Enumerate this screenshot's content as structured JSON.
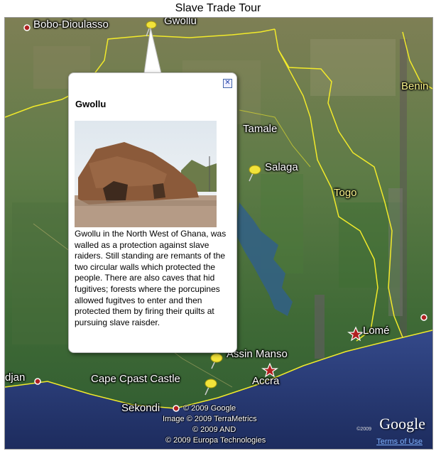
{
  "page_title": "Slave Trade Tour",
  "map": {
    "labels": {
      "bobo": "Bobo-Dioulasso",
      "gwollu_map": "Gwollu",
      "tamale": "Tamale",
      "salaga": "Salaga",
      "benin": "Benin",
      "togo": "Togo",
      "lome": "Lomé",
      "assin_manso": "Assin Manso",
      "accra": "Accra",
      "cape_coast": "Cape Cpast Castle",
      "sekondi": "Sekondi",
      "abidjan": "djan"
    },
    "copyright_lines": [
      "© 2009 Google",
      "Image © 2009 TerraMetrics",
      "© 2009 AND",
      "© 2009 Europa Technologies"
    ],
    "small_copyright": "©2009",
    "google_logo": "Google",
    "terms_link": "Terms of Use",
    "colors": {
      "border": "#f2ea2a",
      "coast": "#f2ea2a",
      "ocean": "#2b3f78"
    }
  },
  "popup": {
    "title": "Gwollu",
    "close_symbol": "✕",
    "description": "Gwollu in the North West of Ghana, was walled as a protection against slave raiders. Still standing are remants of the two circular walls which protected the people. There are also caves that hid fugitives; forests where the porcupines allowed fugitves to enter and then protected them by firing their quilts at pursuing slave raisder."
  }
}
